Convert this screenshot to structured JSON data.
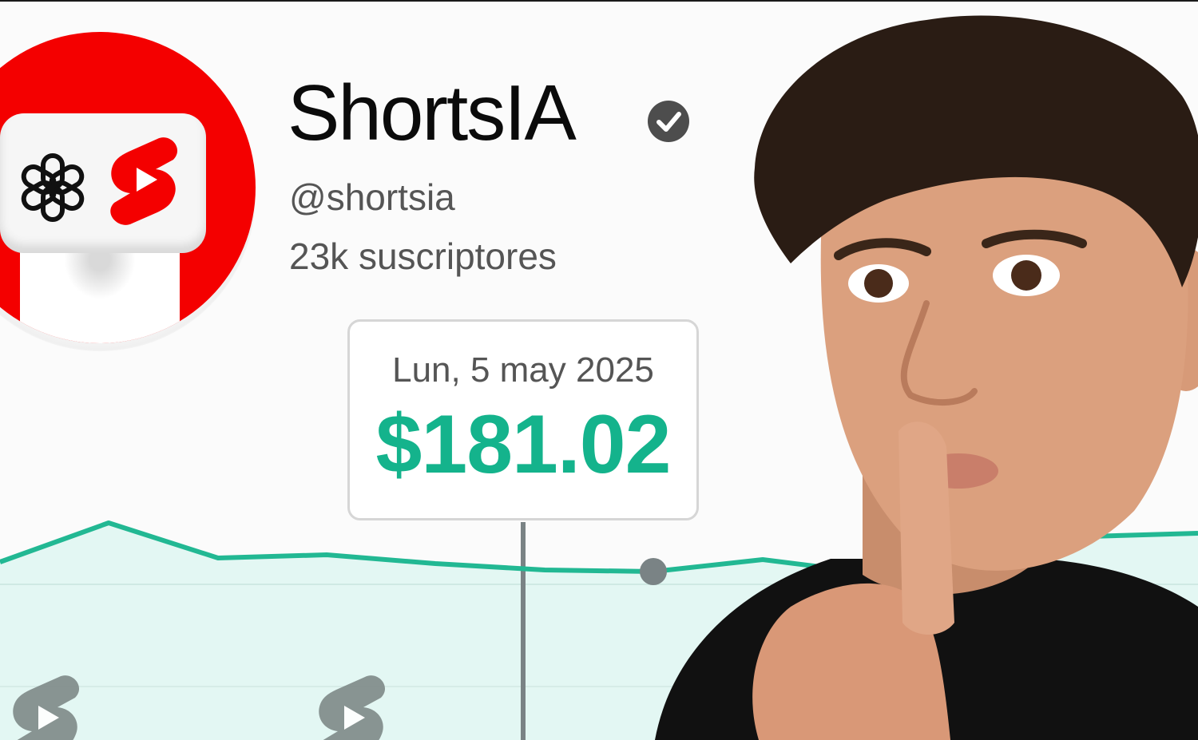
{
  "channel": {
    "name": "ShortsIA",
    "handle": "@shortsia",
    "subscribers": "23k suscriptores",
    "verified": true
  },
  "tooltip": {
    "date": "Lun, 5 may 2025",
    "amount": "$181.02"
  },
  "icons": {
    "verified": "verified-check-icon",
    "openai": "openai-logo-icon",
    "shorts": "youtube-shorts-icon"
  },
  "colors": {
    "accent_green": "#14b38c",
    "line_green": "#22b893",
    "fill_green": "#e3f7f3",
    "brand_red": "#f40000",
    "text_dark": "#0b0b0b",
    "text_gray": "#555555",
    "marker_gray": "#7a8385"
  },
  "chart_data": {
    "type": "area",
    "title": "",
    "xlabel": "",
    "ylabel": "",
    "grid": true,
    "values": [
      65,
      88,
      67,
      69,
      64,
      60,
      59,
      66,
      58,
      88,
      80,
      82
    ],
    "ylim": [
      0,
      100
    ],
    "highlight_index": 6
  }
}
